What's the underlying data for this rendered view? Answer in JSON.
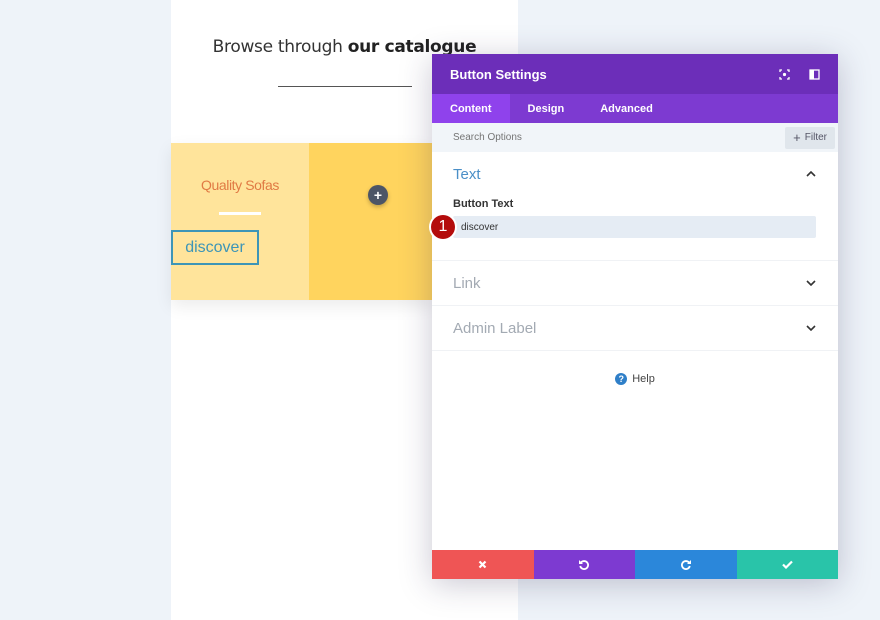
{
  "page": {
    "heading_light": "Browse through ",
    "heading_bold": "our catalogue",
    "card_title": "Quality Sofas",
    "card_button": "discover",
    "add_button": "+"
  },
  "modal": {
    "title": "Button Settings",
    "header_icons": [
      "expand-icon",
      "sidebar-toggle-icon"
    ],
    "tabs": [
      {
        "label": "Content",
        "active": true
      },
      {
        "label": "Design",
        "active": false
      },
      {
        "label": "Advanced",
        "active": false
      }
    ],
    "search": {
      "placeholder": "Search Options",
      "value": ""
    },
    "filter_label": "Filter",
    "sections": {
      "text": {
        "title": "Text",
        "expanded": true,
        "field_label": "Button Text",
        "field_value": "discover",
        "step_badge": "1"
      },
      "link": {
        "title": "Link",
        "expanded": false
      },
      "admin": {
        "title": "Admin Label",
        "expanded": false
      }
    },
    "help_label": "Help",
    "footer": {
      "cancel": "close-icon",
      "undo": "undo-icon",
      "redo": "redo-icon",
      "save": "check-icon"
    }
  },
  "colors": {
    "header": "#6c2eb9",
    "tabs": "#7d3ad1",
    "active_tab": "#8f42ec",
    "cancel": "#ef5555",
    "undo": "#7d3ad1",
    "redo": "#2b87da",
    "save": "#29c4a9",
    "card_light": "#ffe49b",
    "card_dark": "#ffd45e",
    "card_title": "#e07a44",
    "button_border": "#3d95b7"
  }
}
